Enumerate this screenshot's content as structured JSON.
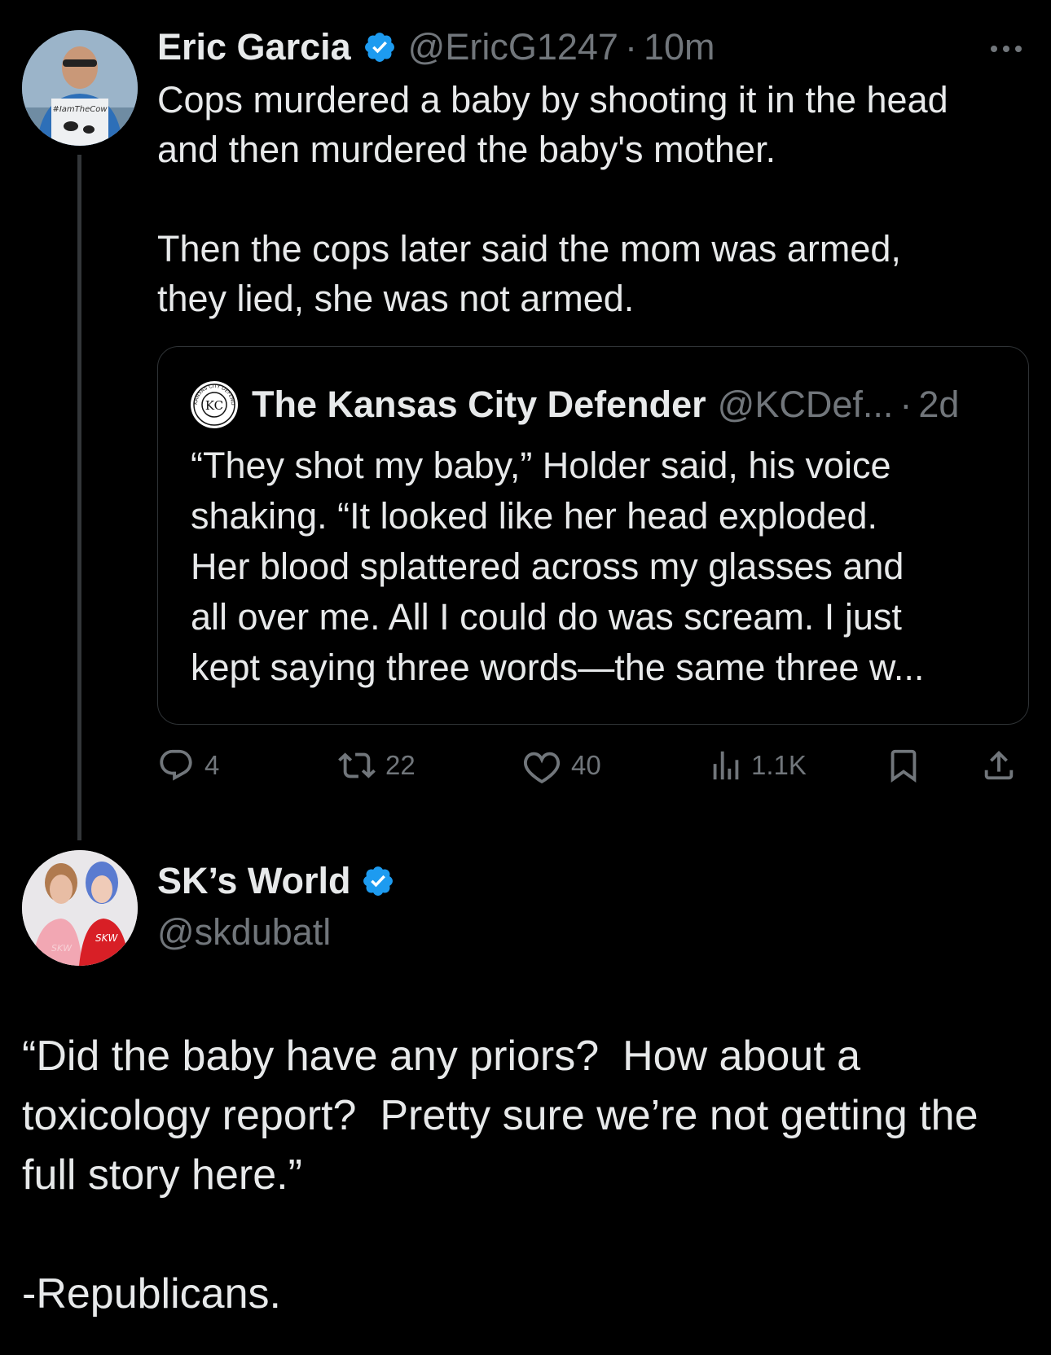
{
  "colors": {
    "background": "#000000",
    "text_primary": "#e7e9ea",
    "text_muted": "#71767b",
    "verified_blue": "#1d9bf0",
    "border": "#2f3336"
  },
  "tweet1": {
    "author_name": "Eric Garcia",
    "handle": "@EricG1247",
    "separator": "·",
    "time": "10m",
    "avatar_icon": "avatar-photo",
    "avatar_shirt_text": "#IamTheCow",
    "more_icon": "more-dots-icon",
    "text": "Cops murdered a baby by shooting it in the head\nand then murdered the baby's mother.\n\nThen the cops later said the mom was armed,\nthey lied, she was not armed.",
    "quote": {
      "author_name": "The Kansas City Defender",
      "handle": "@KCDef...",
      "separator": "·",
      "time": "2d",
      "avatar_logo_text": "KC",
      "avatar_ring_text": "KANSAS CITY DEFENDER",
      "text": "“They shot my baby,” Holder said, his voice\nshaking. “It looked like her head exploded.\nHer blood splattered across my glasses and\nall over me. All I could do was scream. I just\nkept saying three words—the same three w..."
    },
    "actions": {
      "replies": "4",
      "reposts": "22",
      "likes": "40",
      "views": "1.1K"
    }
  },
  "tweet2": {
    "author_name": "SK’s World",
    "handle": "@skdubatl",
    "avatar_icon": "avatar-photo",
    "avatar_shirt_text_left": "SKW",
    "avatar_shirt_text_right": "SKW",
    "text": "“Did the baby have any priors?  How about a\ntoxicology report?  Pretty sure we’re not getting the\nfull story here.”\n\n-Republicans."
  }
}
